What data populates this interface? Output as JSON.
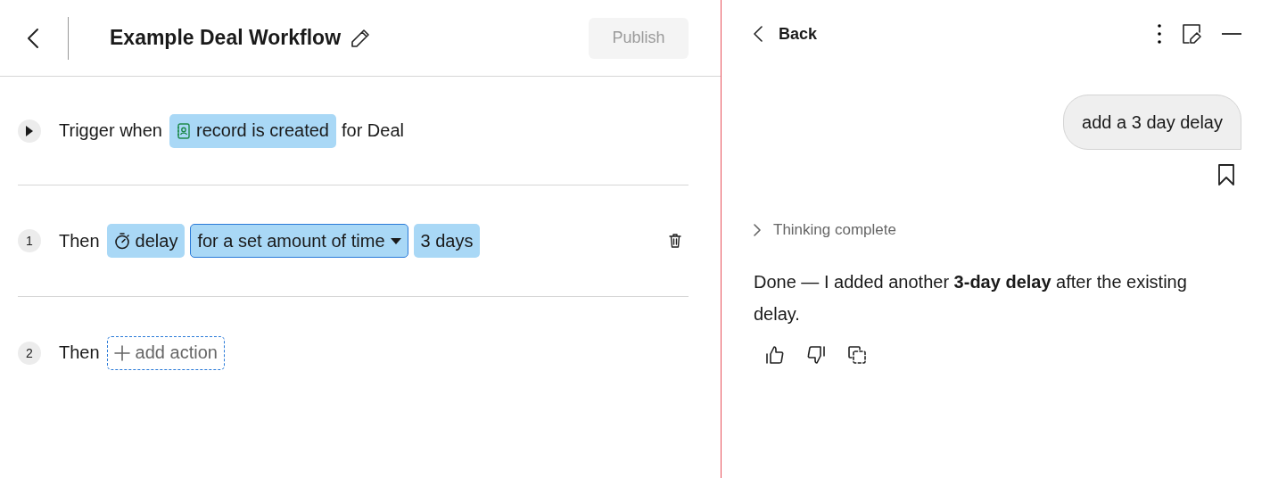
{
  "header": {
    "title": "Example Deal Workflow",
    "publish": {
      "label": "Publish",
      "disabled": true
    }
  },
  "trigger": {
    "expanded": false,
    "prefix": "Trigger when",
    "token": "record is created",
    "suffix": "for Deal"
  },
  "steps": [
    {
      "number": "1",
      "label": "Then",
      "deletable": true,
      "tokens": [
        {
          "kind": "action",
          "text": "delay"
        },
        {
          "kind": "select",
          "text": "for a set amount of time"
        },
        {
          "kind": "value",
          "text": "3 days"
        }
      ]
    },
    {
      "number": "2",
      "label": "Then",
      "deletable": false,
      "tokens": [
        {
          "kind": "add",
          "text": "add action"
        }
      ]
    }
  ],
  "chat": {
    "back": "Back",
    "user_message": "add a 3 day delay",
    "thinking": "Thinking complete",
    "reply": "Done — I added another **3-day delay** after the existing delay."
  }
}
